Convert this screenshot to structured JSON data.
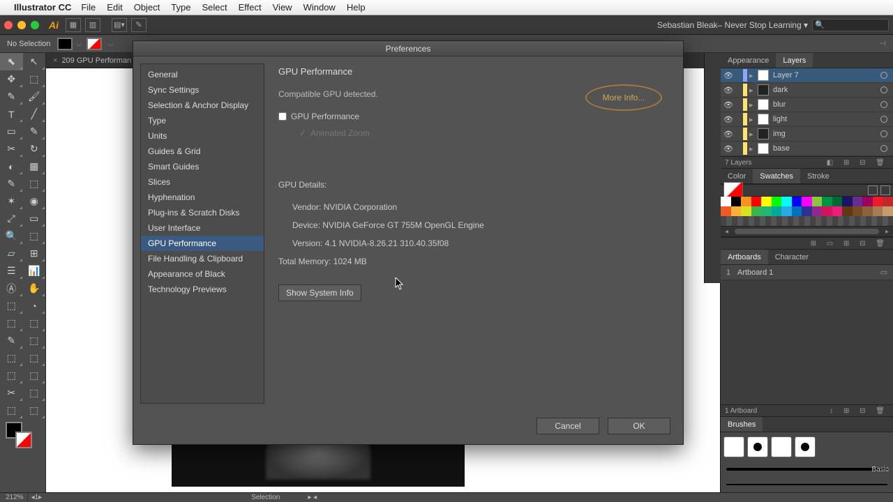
{
  "menubar": {
    "app_name": "Illustrator CC",
    "items": [
      "File",
      "Edit",
      "Object",
      "Type",
      "Select",
      "Effect",
      "View",
      "Window",
      "Help"
    ]
  },
  "appbar": {
    "workspace": "Sebastian Bleak– Never Stop Learning",
    "search_placeholder": " "
  },
  "options_bar": {
    "selection_label": "No Selection"
  },
  "document_tab": {
    "title": "209 GPU Performan"
  },
  "statusbar": {
    "zoom": "212%",
    "mode": "Selection"
  },
  "dialog": {
    "title": "Preferences",
    "categories": [
      "General",
      "Sync Settings",
      "Selection & Anchor Display",
      "Type",
      "Units",
      "Guides & Grid",
      "Smart Guides",
      "Slices",
      "Hyphenation",
      "Plug-ins & Scratch Disks",
      "User Interface",
      "GPU Performance",
      "File Handling & Clipboard",
      "Appearance of Black",
      "Technology Previews"
    ],
    "selected_index": 11,
    "pane": {
      "heading": "GPU Performance",
      "status": "Compatible GPU detected.",
      "more_info": "More Info...",
      "chk_gpu": "GPU Performance",
      "chk_zoom": "Animated Zoom",
      "details_heading": "GPU Details:",
      "vendor_label": "Vendor:",
      "vendor": "NVIDIA Corporation",
      "device_label": "Device:",
      "device": "NVIDIA GeForce GT 755M OpenGL Engine",
      "version_label": "Version:",
      "version": "4.1 NVIDIA-8.26.21 310.40.35f08",
      "memory_label": "Total Memory:",
      "memory": "1024 MB",
      "show_system": "Show System Info"
    },
    "buttons": {
      "cancel": "Cancel",
      "ok": "OK"
    }
  },
  "panels": {
    "appearance_tab": "Appearance",
    "layers_tab": "Layers",
    "layers": [
      {
        "name": "Layer 7",
        "color": "#8aa6ff",
        "thumb": "light",
        "sel": true
      },
      {
        "name": "dark",
        "color": "#ffe36b",
        "thumb": "dark"
      },
      {
        "name": "blur",
        "color": "#ffe36b",
        "thumb": "light"
      },
      {
        "name": "light",
        "color": "#ffe36b",
        "thumb": "light"
      },
      {
        "name": "img",
        "color": "#ffe36b",
        "thumb": "dark"
      },
      {
        "name": "base",
        "color": "#ffe36b",
        "thumb": "light"
      }
    ],
    "layers_footer": "7 Layers",
    "color_tab": "Color",
    "swatches_tab": "Swatches",
    "stroke_tab": "Stroke",
    "artboards_tab": "Artboards",
    "character_tab": "Character",
    "artboard_num": "1",
    "artboard_name": "Artboard 1",
    "artboard_footer": "1 Artboard",
    "brushes_tab": "Brushes",
    "brush_basic": "Basic"
  },
  "swatches": [
    "#ffffff",
    "#000000",
    "#f7931e",
    "#ff0000",
    "#ffff00",
    "#00ff00",
    "#00ffff",
    "#0000ff",
    "#ff00ff",
    "#8cc63f",
    "#009245",
    "#006837",
    "#1b1464",
    "#662d91",
    "#9e005d",
    "#ed1c24",
    "#c1272d",
    "#f15a24",
    "#fbb03b",
    "#d9e021",
    "#39b54a",
    "#22b573",
    "#00a99d",
    "#29abe2",
    "#0071bc",
    "#2e3192",
    "#93278f",
    "#d4145a",
    "#ed1e79",
    "#603813",
    "#754c24",
    "#8c6239",
    "#a67c52",
    "#c69c6d"
  ],
  "colors": {
    "accent": "#3b5a82",
    "highlight": "#d4a757"
  }
}
